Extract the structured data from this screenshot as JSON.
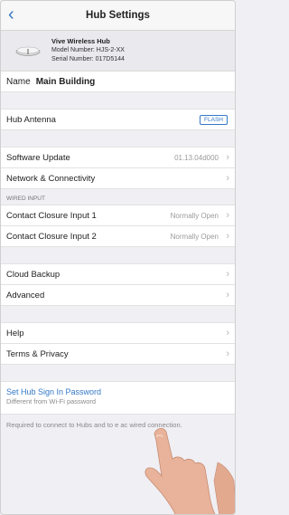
{
  "nav": {
    "back_icon": "chevron-left-icon",
    "title": "Hub Settings"
  },
  "hub": {
    "name": "Vive Wireless Hub",
    "model": "Model Number: HJS-2-XX",
    "serial": "Serial Number: 017D5144"
  },
  "name_row": {
    "label": "Name",
    "value": "Main Building"
  },
  "antenna": {
    "label": "Hub Antenna",
    "button": "FLASH"
  },
  "software": {
    "label": "Software Update",
    "value": "01.13.04d000"
  },
  "network": {
    "label": "Network & Connectivity"
  },
  "wired": {
    "header": "WIRED INPUT",
    "items": [
      {
        "label": "Contact Closure Input 1",
        "value": "Normally Open"
      },
      {
        "label": "Contact Closure Input 2",
        "value": "Normally Open"
      }
    ]
  },
  "cloud": {
    "label": "Cloud Backup"
  },
  "advanced": {
    "label": "Advanced"
  },
  "help": {
    "label": "Help"
  },
  "terms": {
    "label": "Terms & Privacy"
  },
  "password": {
    "link": "Set Hub Sign In Password",
    "sub": "Different from Wi-Fi password"
  },
  "footnote": "Required to connect to Hubs and to       e ac               wired connection.",
  "colors": {
    "accent": "#3478c6",
    "background": "#efeff4"
  }
}
